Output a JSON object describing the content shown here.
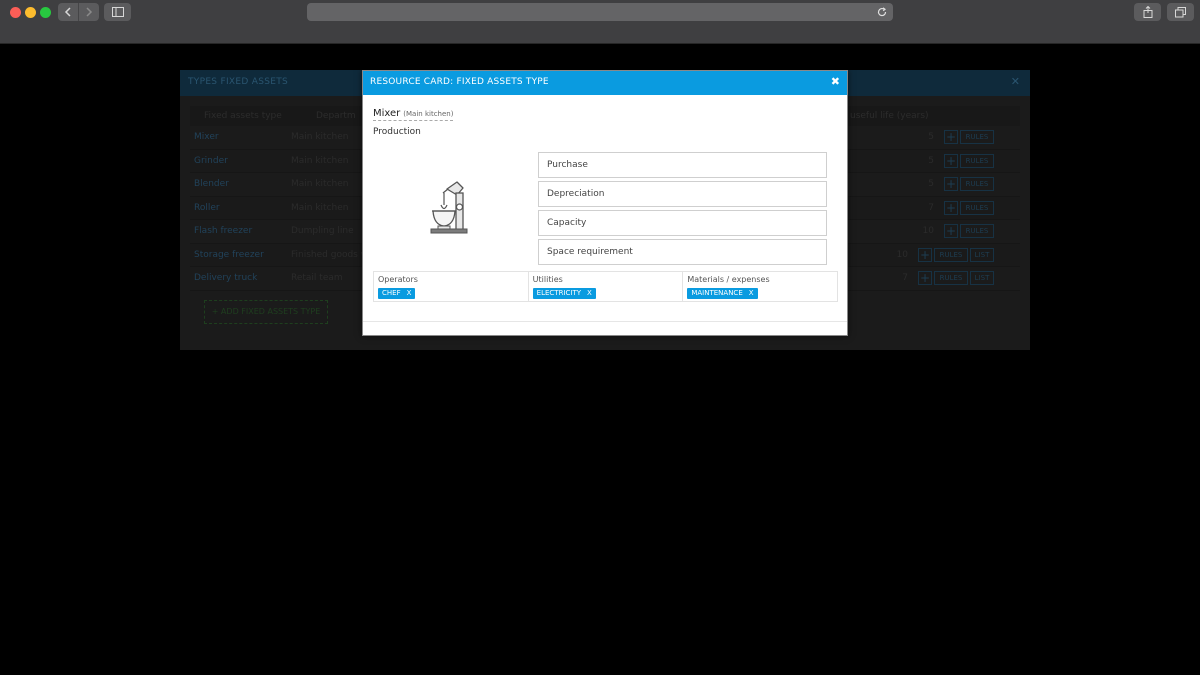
{
  "background": {
    "title": "TYPES FIXED ASSETS",
    "close": "✕",
    "columns": {
      "type": "Fixed assets type",
      "department": "Departm",
      "life": "useful life (years)"
    },
    "rows": [
      {
        "type": "Mixer",
        "department": "Main kitchen",
        "life": "5",
        "rules": "RULES",
        "list": ""
      },
      {
        "type": "Grinder",
        "department": "Main kitchen",
        "life": "5",
        "rules": "RULES",
        "list": ""
      },
      {
        "type": "Blender",
        "department": "Main kitchen",
        "life": "5",
        "rules": "RULES",
        "list": ""
      },
      {
        "type": "Roller",
        "department": "Main kitchen",
        "life": "7",
        "rules": "RULES",
        "list": ""
      },
      {
        "type": "Flash freezer",
        "department": "Dumpling line",
        "life": "10",
        "rules": "RULES",
        "list": ""
      },
      {
        "type": "Storage freezer",
        "department": "Finished goods w",
        "life": "10",
        "rules": "RULES",
        "list": "LIST"
      },
      {
        "type": "Delivery truck",
        "department": "Retail team",
        "life": "7",
        "rules": "RULES",
        "list": "LIST"
      }
    ],
    "add_button": "+ ADD FIXED ASSETS TYPE"
  },
  "modal": {
    "title": "RESOURCE CARD: FIXED ASSETS TYPE",
    "close": "✖",
    "asset_name": "Mixer",
    "department": "(Main kitchen)",
    "category": "Production",
    "icon": "stand-mixer-icon",
    "buttons": [
      "Purchase",
      "Depreciation",
      "Capacity",
      "Space requirement"
    ],
    "resources": [
      {
        "label": "Operators",
        "tag": "CHEF"
      },
      {
        "label": "Utilities",
        "tag": "ELECTRICITY"
      },
      {
        "label": "Materials / expenses",
        "tag": "MAINTENANCE"
      }
    ],
    "tag_remove": "X"
  },
  "colors": {
    "accent": "#0a9be0",
    "chrome": "#3f3f41"
  }
}
